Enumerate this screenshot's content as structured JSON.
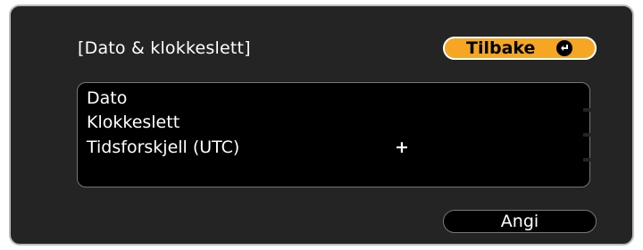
{
  "dialog": {
    "title": "[Dato & klokkeslett]",
    "back_button": {
      "label": "Tilbake",
      "icon": "enter-icon"
    }
  },
  "items": [
    {
      "label": "Dato",
      "value": ""
    },
    {
      "label": "Klokkeslett",
      "value": ""
    },
    {
      "label": "Tidsforskjell (UTC)",
      "value": "+"
    },
    {
      "label": "",
      "value": ""
    }
  ],
  "set_button": {
    "label": "Angi"
  },
  "colors": {
    "panel_bg": "#242424",
    "list_bg": "#000000",
    "accent": "#f5a623",
    "text": "#ffffff"
  }
}
